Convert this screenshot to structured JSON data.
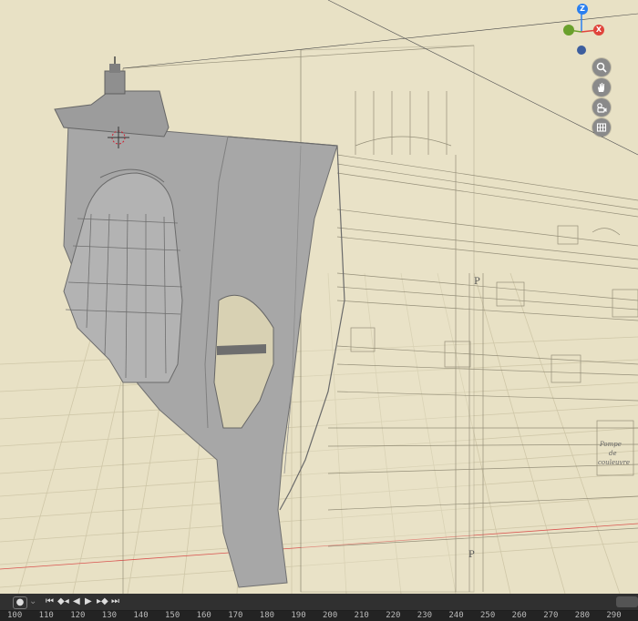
{
  "gizmo": {
    "z_label": "Z",
    "x_label": "X",
    "y_label": "",
    "z_color": "#2a7ff0",
    "x_color": "#e0443c",
    "y_color": "#6aa02c",
    "neg_color": "#3d5e9e"
  },
  "nav": {
    "zoom_icon": "zoom-icon",
    "pan_icon": "hand-pan-icon",
    "camera_icon": "camera-view-icon",
    "grid_icon": "ortho-grid-icon"
  },
  "timeline": {
    "frame_marks": [
      "100",
      "110",
      "120",
      "130",
      "140",
      "150",
      "160",
      "170",
      "180",
      "190",
      "200",
      "210",
      "220",
      "230",
      "240",
      "250",
      "260",
      "270",
      "280",
      "290"
    ],
    "playback_icons": [
      "jump-start-icon",
      "prev-keyframe-icon",
      "play-reverse-icon",
      "play-icon",
      "next-keyframe-icon",
      "jump-end-icon"
    ]
  },
  "blueprint": {
    "label_p1": "P",
    "label_p2": "P",
    "note": "Pompe de couleuvre"
  }
}
